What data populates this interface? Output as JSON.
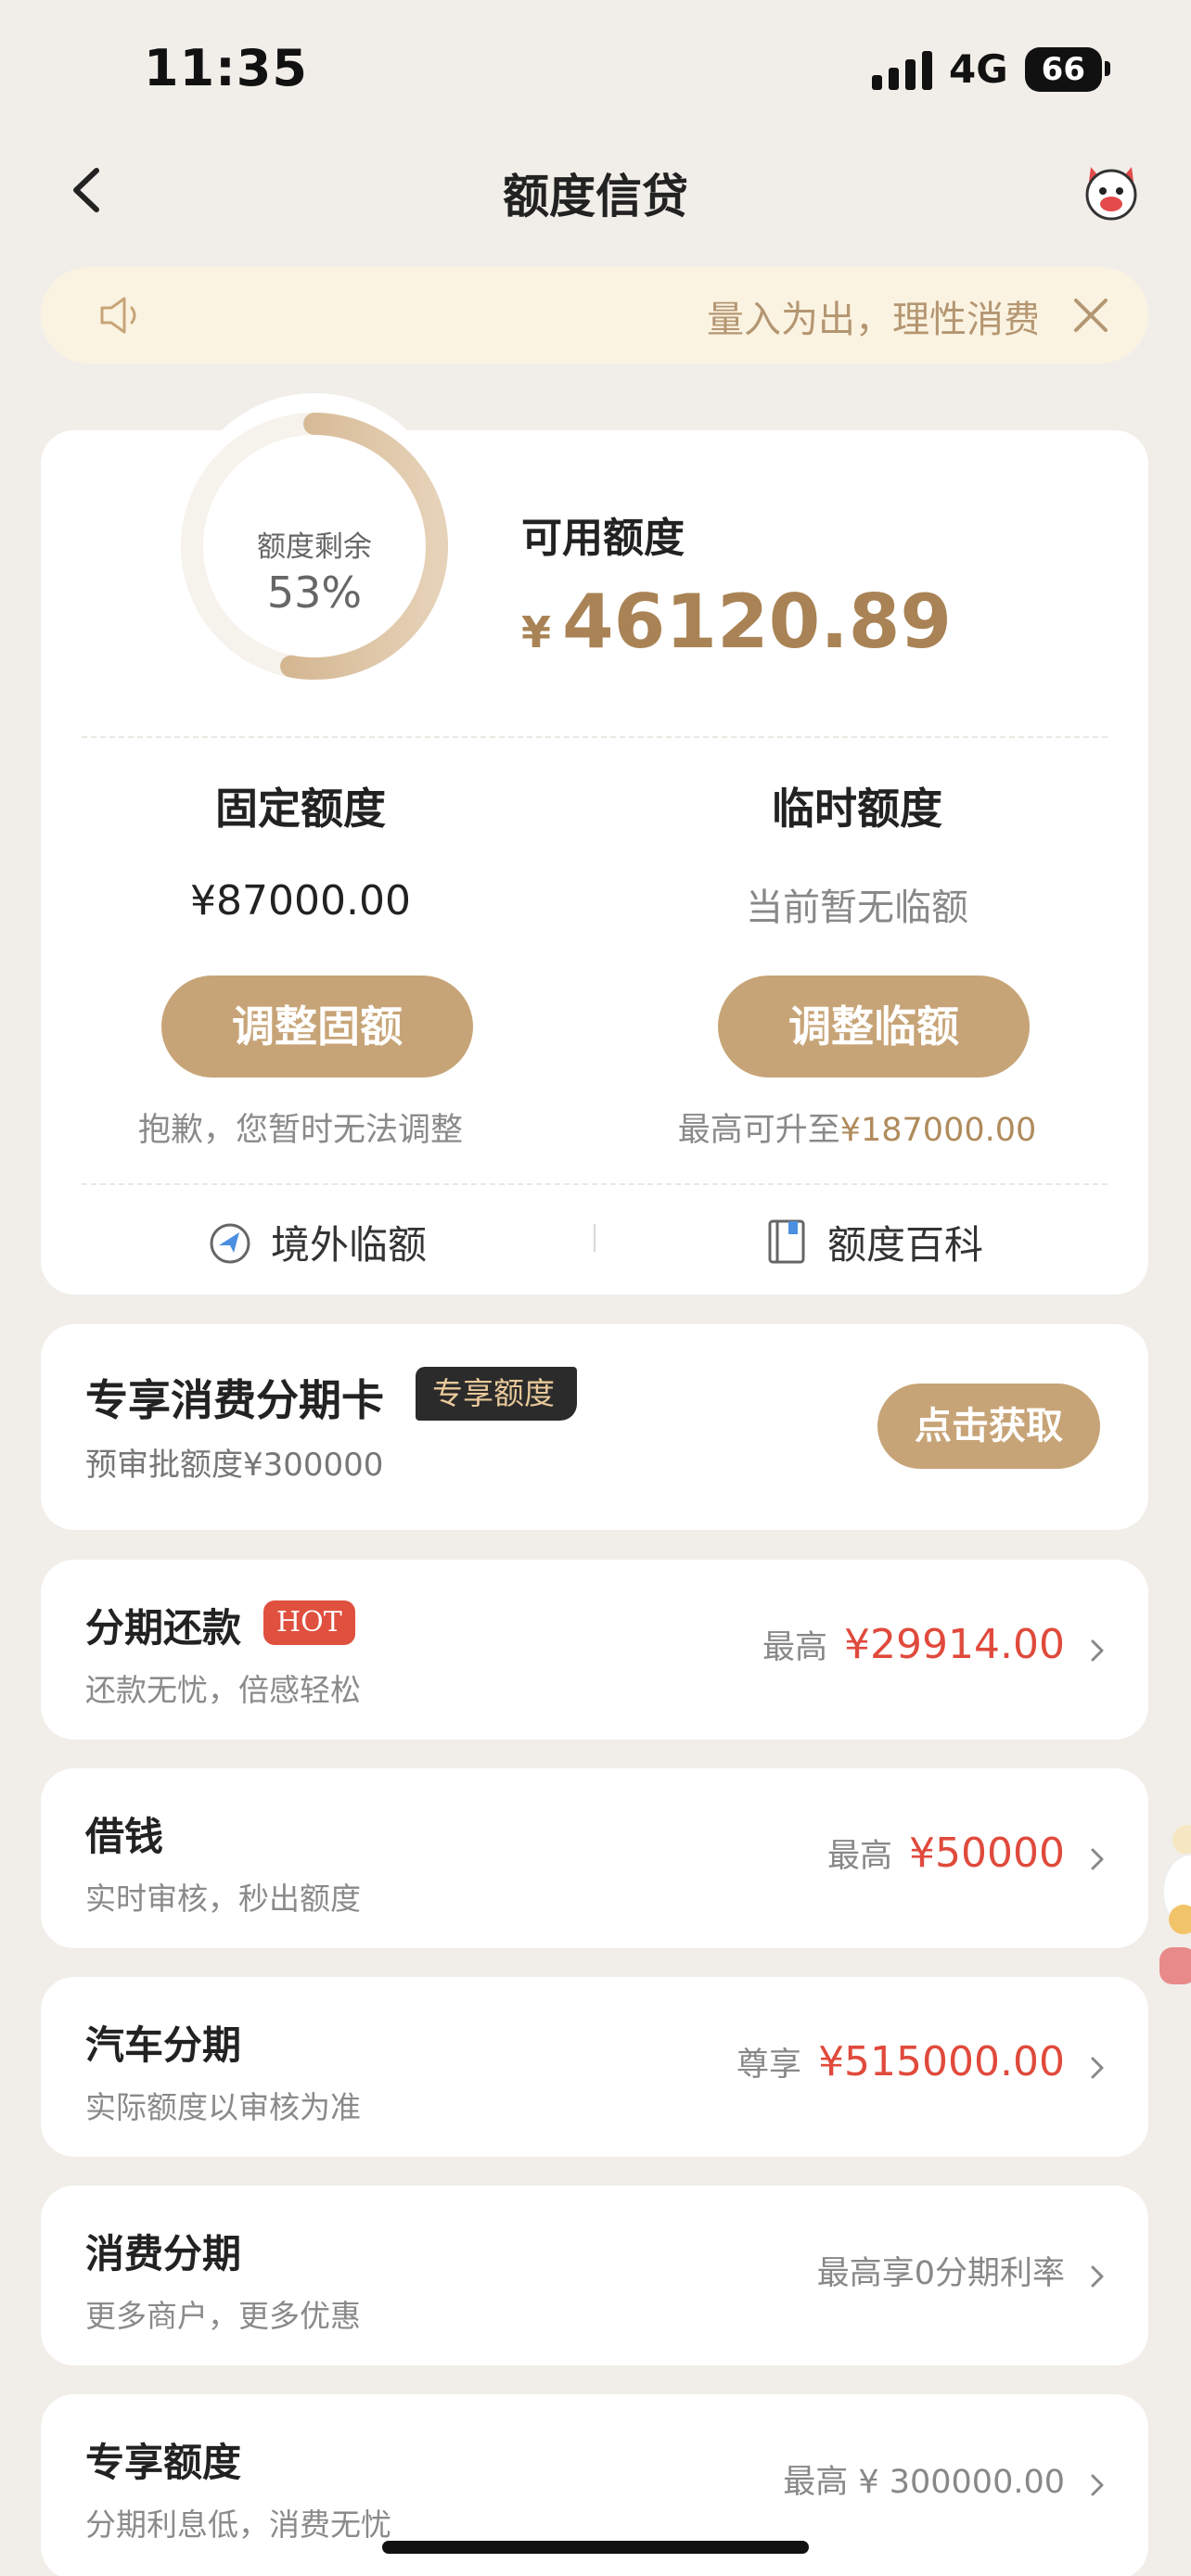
{
  "status_bar": {
    "time": "11:35",
    "network": "4G",
    "battery": "66"
  },
  "nav": {
    "title": "额度信贷"
  },
  "notice": {
    "text": "量入为出，理性消费"
  },
  "quota": {
    "remaining_label": "额度剩余",
    "remaining_percent": "53%",
    "remaining_fraction": 0.53,
    "available_label": "可用额度",
    "currency_symbol": "¥",
    "available_amount": "46120.89",
    "fixed": {
      "title": "固定额度",
      "value": "¥87000.00",
      "button": "调整固额",
      "note": "抱歉，您暂时无法调整"
    },
    "temporary": {
      "title": "临时额度",
      "value": "当前暂无临额",
      "button": "调整临额",
      "note_prefix": "最高可升至",
      "note_amount": "¥187000.00"
    },
    "links": {
      "overseas": "境外临额",
      "encyclopedia": "额度百科"
    }
  },
  "promo": {
    "title": "专享消费分期卡",
    "badge": "专享额度",
    "subtitle": "预审批额度¥300000",
    "button": "点击获取"
  },
  "list": [
    {
      "title": "分期还款",
      "badge": "HOT",
      "subtitle": "还款无忧，倍感轻松",
      "prefix": "最高",
      "amount": "¥29914.00"
    },
    {
      "title": "借钱",
      "subtitle": "实时审核，秒出额度",
      "prefix": "最高",
      "amount": "¥50000"
    },
    {
      "title": "汽车分期",
      "subtitle": "实际额度以审核为准",
      "prefix": "尊享",
      "amount": "¥515000.00"
    },
    {
      "title": "消费分期",
      "subtitle": "更多商户，更多优惠",
      "prefix": "最高享0分期利率",
      "amount": ""
    },
    {
      "title": "专享额度",
      "subtitle": "分期利息低，消费无忧",
      "prefix": "最高 ¥ 300000.00",
      "amount": ""
    }
  ],
  "colors": {
    "accent_gold": "#c7a477",
    "amount_gold": "#a98355",
    "amount_red": "#e04a3c",
    "background": "#f1eee9"
  }
}
